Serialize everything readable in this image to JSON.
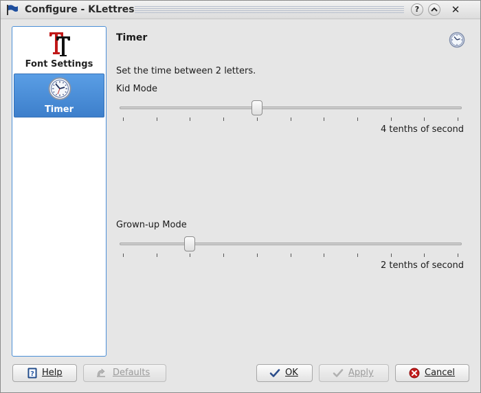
{
  "window": {
    "title": "Configure - KLettres",
    "buttons": {
      "help": "?",
      "shade": "^",
      "close": "✕"
    }
  },
  "sidebar": {
    "items": [
      {
        "label": "Font Settings",
        "icon": "font-tt-icon",
        "selected": false
      },
      {
        "label": "Timer",
        "icon": "clock-icon",
        "selected": true
      }
    ]
  },
  "page": {
    "title": "Timer",
    "description": "Set the time between 2 letters.",
    "kid": {
      "label": "Kid Mode",
      "value": 4,
      "min": 0,
      "max": 10,
      "value_text": "4 tenths of second"
    },
    "grownup": {
      "label": "Grown-up Mode",
      "value": 2,
      "min": 0,
      "max": 10,
      "value_text": "2 tenths of second"
    }
  },
  "buttons": {
    "help": "Help",
    "defaults": "Defaults",
    "ok": "OK",
    "apply": "Apply",
    "cancel": "Cancel"
  },
  "colors": {
    "selection": "#4a8ed6",
    "window_bg": "#e6e6e6"
  }
}
